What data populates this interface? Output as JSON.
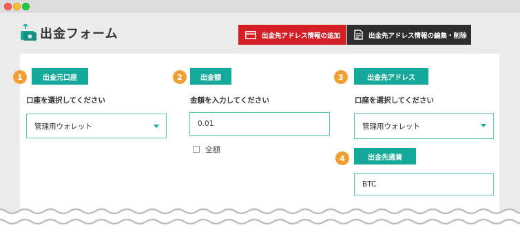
{
  "header": {
    "title": "出金フォーム",
    "buttons": {
      "add_label": "出金先アドレス情報の追加",
      "edit_label": "出金先アドレス情報の編集・削除"
    }
  },
  "form": {
    "source_account": {
      "step": "1",
      "tag": "出金元口座",
      "label": "口座を選択してください",
      "selected": "管理用ウォレット"
    },
    "amount": {
      "step": "2",
      "tag": "出金額",
      "label": "金額を入力してください",
      "value": "0.01",
      "all_amount_label": "全額"
    },
    "destination_address": {
      "step": "3",
      "tag": "出金先アドレス",
      "label": "口座を選択してください",
      "selected": "管理用ウォレット"
    },
    "destination_currency": {
      "step": "4",
      "tag": "出金先通貨",
      "value": "BTC"
    }
  },
  "colors": {
    "accent": "#14a99a",
    "step": "#f0a033",
    "add_button": "#d41f27",
    "edit_button": "#2d2d2d"
  }
}
